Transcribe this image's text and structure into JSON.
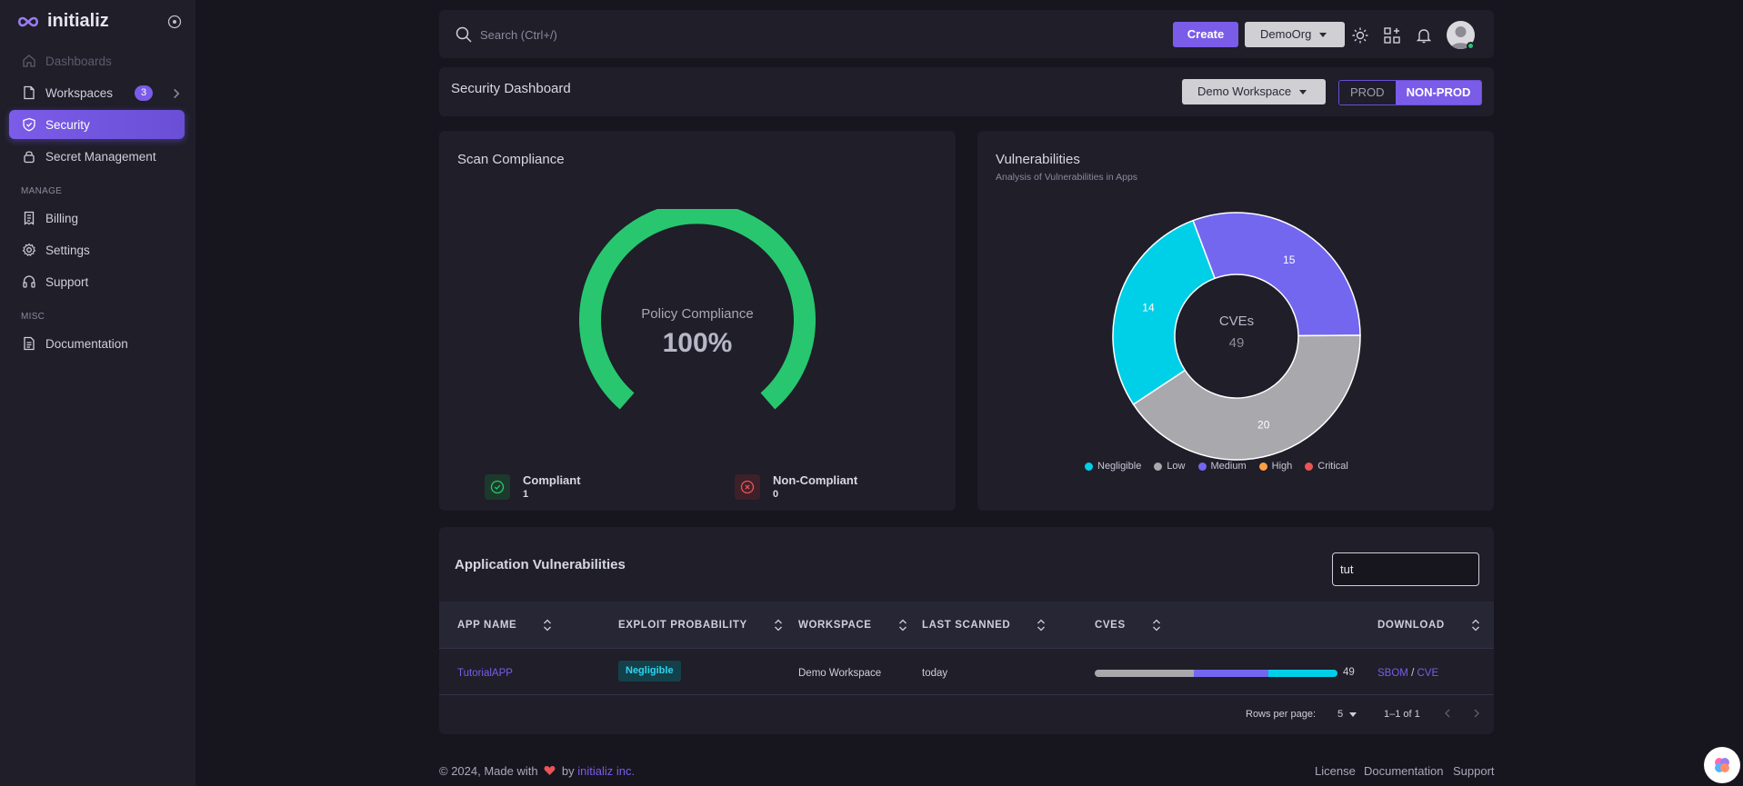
{
  "brand": {
    "name": "initializ"
  },
  "sidebar": {
    "items": [
      {
        "label": "Dashboards"
      },
      {
        "label": "Workspaces",
        "badge": "3"
      },
      {
        "label": "Security"
      },
      {
        "label": "Secret Management"
      }
    ],
    "section_manage": "MANAGE",
    "manage_items": [
      {
        "label": "Billing"
      },
      {
        "label": "Settings"
      },
      {
        "label": "Support"
      }
    ],
    "section_misc": "MISC",
    "misc_items": [
      {
        "label": "Documentation"
      }
    ]
  },
  "topbar": {
    "search_placeholder": "Search (Ctrl+/)",
    "create_label": "Create",
    "org_label": "DemoOrg"
  },
  "header": {
    "title": "Security Dashboard",
    "workspace_label": "Demo Workspace",
    "env_prod": "PROD",
    "env_nonprod": "NON-PROD"
  },
  "compliance": {
    "title": "Scan Compliance",
    "gauge_label": "Policy Compliance",
    "gauge_value": "100%",
    "compliant_label": "Compliant",
    "compliant_count": "1",
    "noncompliant_label": "Non-Compliant",
    "noncompliant_count": "0",
    "accent": "#28c76f"
  },
  "vulnerabilities": {
    "title": "Vulnerabilities",
    "subtitle": "Analysis of Vulnerabilities in Apps",
    "center_label": "CVEs",
    "center_value": "49",
    "legend": [
      {
        "name": "Negligible",
        "color": "#00cfe8"
      },
      {
        "name": "Low",
        "color": "#a8a8ad"
      },
      {
        "name": "Medium",
        "color": "#7367f0"
      },
      {
        "name": "High",
        "color": "#ff9f43"
      },
      {
        "name": "Critical",
        "color": "#ea5455"
      }
    ]
  },
  "chart_data": {
    "type": "pie",
    "categories": [
      "Negligible",
      "Low",
      "Medium",
      "High",
      "Critical"
    ],
    "values": [
      14,
      20,
      15,
      0,
      0
    ],
    "colors": [
      "#00cfe8",
      "#a8a8ad",
      "#7367f0",
      "#ff9f43",
      "#ea5455"
    ],
    "title": "Vulnerabilities",
    "subtitle": "Analysis of Vulnerabilities in Apps",
    "donut": true,
    "center_text": "CVEs 49",
    "legend_position": "bottom"
  },
  "table": {
    "title": "Application Vulnerabilities",
    "filter_value": "tut",
    "headers": {
      "app_name": "APP NAME",
      "exploit": "EXPLOIT PROBABILITY",
      "workspace": "WORKSPACE",
      "last_scanned": "LAST SCANNED",
      "cves": "CVES",
      "download": "DOWNLOAD"
    },
    "rows": [
      {
        "app_name": "TutorialAPP",
        "exploit": "Negligible",
        "workspace": "Demo Workspace",
        "last_scanned": "today",
        "cves_total": "49",
        "cve_breakdown": {
          "low": 20,
          "medium": 15,
          "negligible": 14
        },
        "download_sbom": "SBOM",
        "download_sep": "/",
        "download_cve": "CVE"
      }
    ],
    "rows_per_page_label": "Rows per page:",
    "rows_per_page_value": "5",
    "range": "1–1 of 1"
  },
  "footer": {
    "copyright": "© 2024, Made with",
    "by": "by",
    "company": "initializ inc.",
    "links": [
      "License",
      "Documentation",
      "Support"
    ]
  }
}
